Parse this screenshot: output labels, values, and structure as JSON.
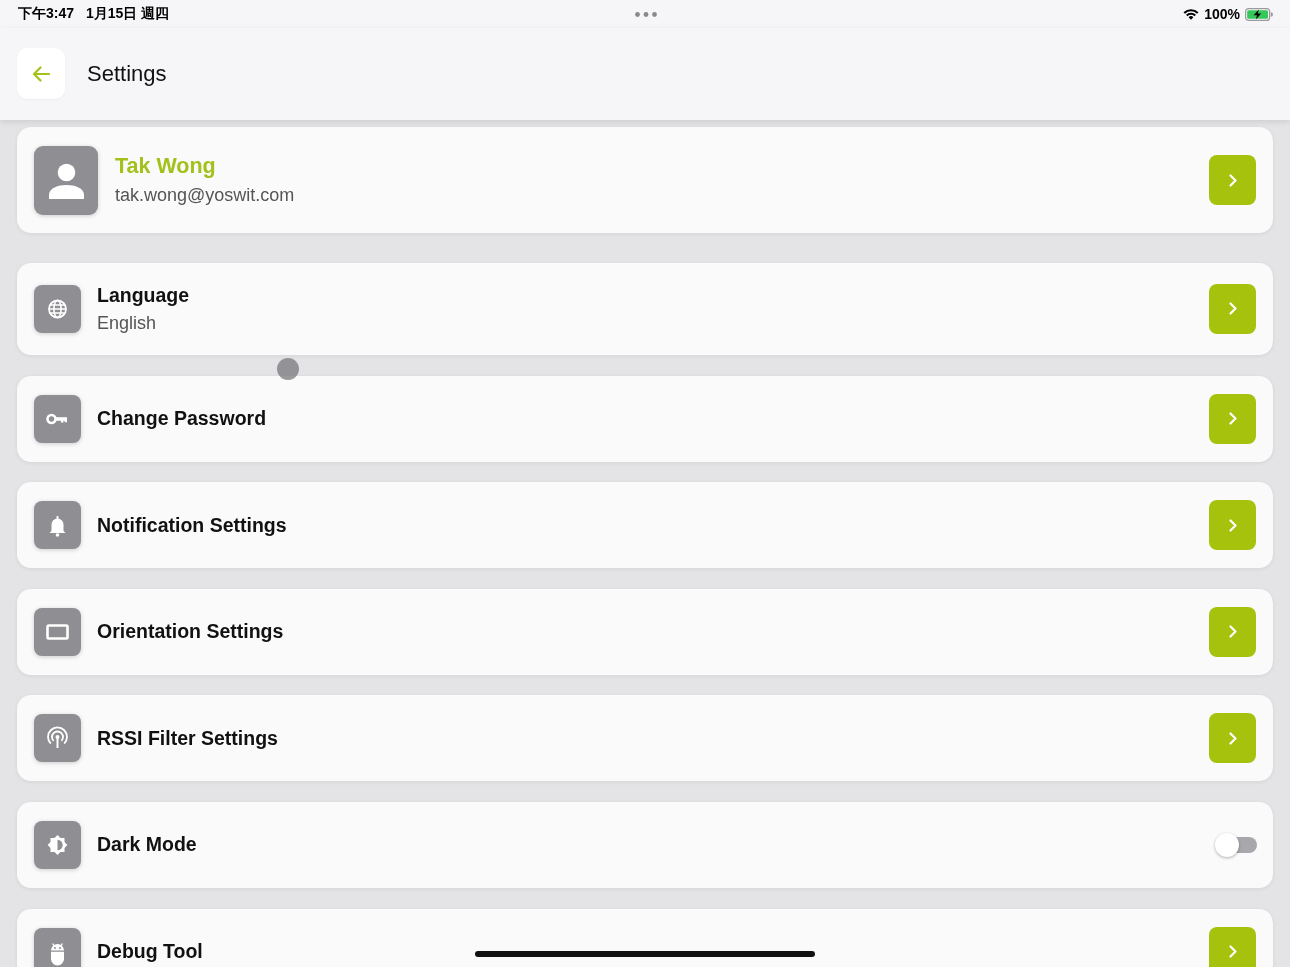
{
  "status_bar": {
    "time": "下午3:47",
    "date": "1月15日 週四",
    "battery": "100%"
  },
  "header": {
    "title": "Settings"
  },
  "profile": {
    "name": "Tak Wong",
    "email": "tak.wong@yoswit.com"
  },
  "items": [
    {
      "kind": "link",
      "title": "Language",
      "subtitle": "English"
    },
    {
      "kind": "link",
      "title": "Change Password"
    },
    {
      "kind": "link",
      "title": "Notification Settings"
    },
    {
      "kind": "link",
      "title": "Orientation Settings"
    },
    {
      "kind": "link",
      "title": "RSSI Filter Settings"
    },
    {
      "kind": "toggle",
      "title": "Dark Mode",
      "on": false
    },
    {
      "kind": "link",
      "title": "Debug Tool"
    }
  ]
}
